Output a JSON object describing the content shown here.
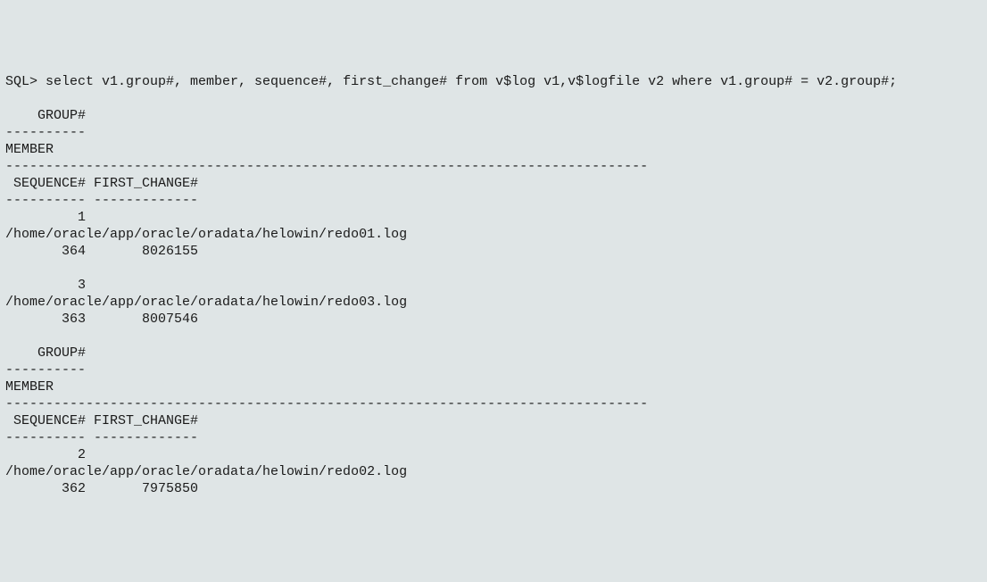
{
  "sql": {
    "prompt": "SQL> ",
    "query": "select v1.group#, member, sequence#, first_change# from v$log v1,v$logfile v2 where v1.group# = v2.group#;"
  },
  "headers": {
    "group": "    GROUP#",
    "group_sep": "----------",
    "member": "MEMBER",
    "member_sep": "--------------------------------------------------------------------------------",
    "seq_change": " SEQUENCE# FIRST_CHANGE#",
    "seq_change_sep": "---------- -------------"
  },
  "rows": [
    {
      "group": "         1",
      "member": "/home/oracle/app/oracle/oradata/helowin/redo01.log",
      "seq_change": "       364       8026155"
    },
    {
      "group": "         3",
      "member": "/home/oracle/app/oracle/oradata/helowin/redo03.log",
      "seq_change": "       363       8007546"
    },
    {
      "group": "         2",
      "member": "/home/oracle/app/oracle/oradata/helowin/redo02.log",
      "seq_change": "       362       7975850"
    }
  ]
}
